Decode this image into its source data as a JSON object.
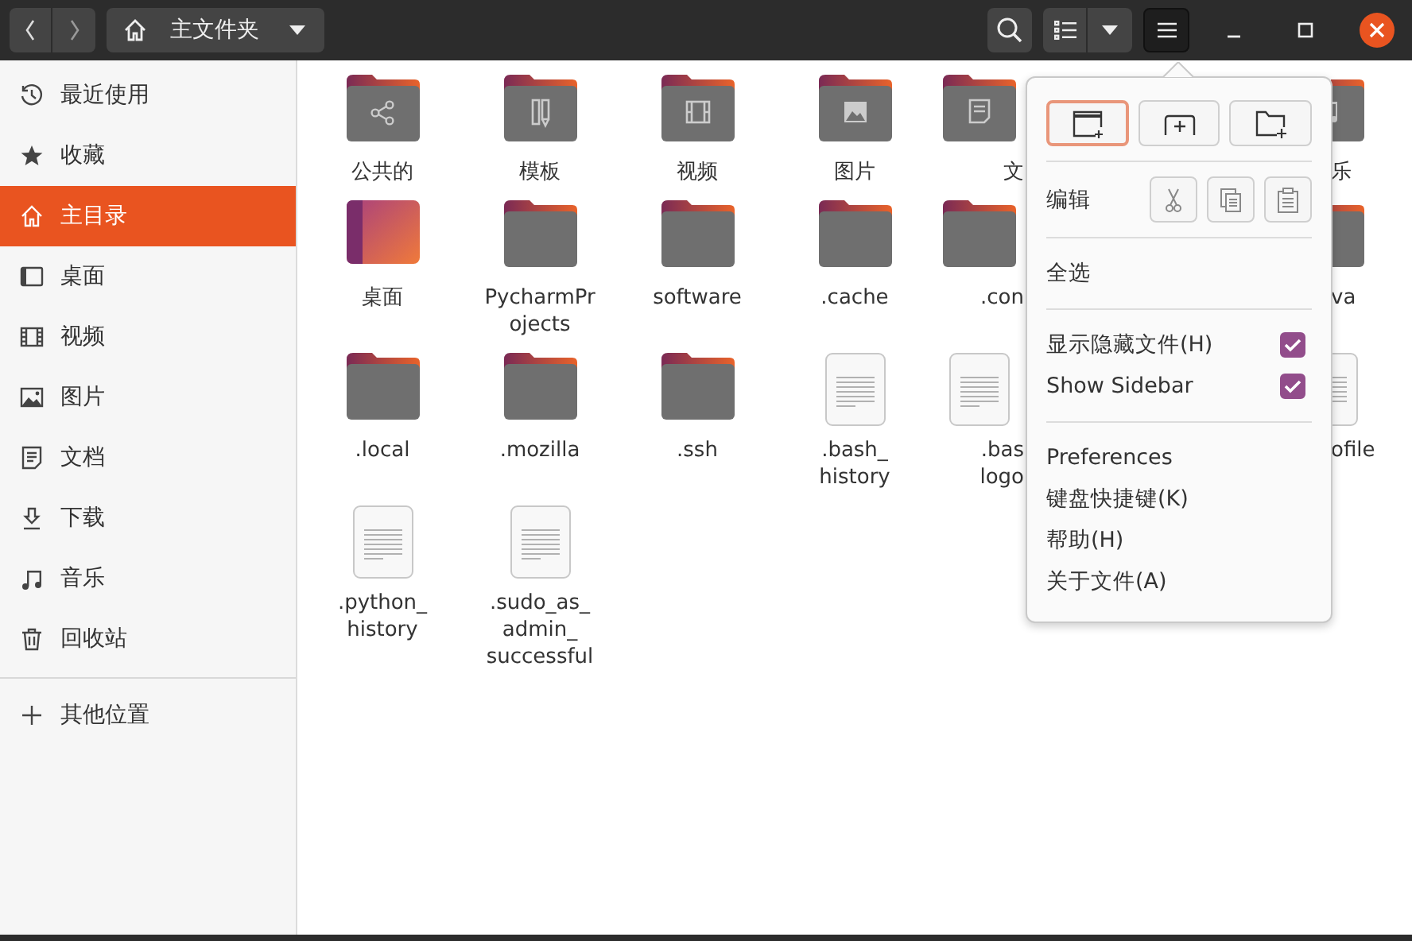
{
  "header": {
    "location": "主文件夹"
  },
  "sidebar": {
    "items": [
      {
        "label": "最近使用",
        "kind": "recent",
        "selected": false
      },
      {
        "label": "收藏",
        "kind": "starred",
        "selected": false
      },
      {
        "label": "主目录",
        "kind": "home",
        "selected": true
      },
      {
        "label": "桌面",
        "kind": "desktop",
        "selected": false
      },
      {
        "label": "视频",
        "kind": "video",
        "selected": false
      },
      {
        "label": "图片",
        "kind": "pictures",
        "selected": false
      },
      {
        "label": "文档",
        "kind": "documents",
        "selected": false
      },
      {
        "label": "下载",
        "kind": "downloads",
        "selected": false
      },
      {
        "label": "音乐",
        "kind": "music",
        "selected": false
      },
      {
        "label": "回收站",
        "kind": "trash",
        "selected": false
      }
    ],
    "other": {
      "label": "其他位置"
    }
  },
  "files": {
    "rows": [
      {
        "items": [
          {
            "name_lines": [
              "公共的"
            ],
            "kind": "share"
          },
          {
            "name_lines": [
              "模板"
            ],
            "kind": "templates"
          },
          {
            "name_lines": [
              "视频"
            ],
            "kind": "video"
          },
          {
            "name_lines": [
              "图片"
            ],
            "kind": "pictures"
          },
          {
            "name_lines": [
              "文"
            ],
            "kind": "documents",
            "covered_right": true
          },
          {
            "name_lines": [
              "乐"
            ],
            "kind": "music",
            "covered_left": true
          }
        ]
      },
      {
        "items": [
          {
            "name_lines": [
              "桌面"
            ],
            "kind": "desktop"
          },
          {
            "name_lines": [
              "PycharmPr",
              "ojects"
            ],
            "kind": "folder"
          },
          {
            "name_lines": [
              "software"
            ],
            "kind": "folder"
          },
          {
            "name_lines": [
              ".cache"
            ],
            "kind": "folder"
          },
          {
            "name_lines": [
              ".con"
            ],
            "kind": "folder",
            "covered_right": true
          },
          {
            "name_lines": [
              "va"
            ],
            "kind": "folder",
            "covered_left": true
          }
        ]
      },
      {
        "items": [
          {
            "name_lines": [
              ".local"
            ],
            "kind": "folder"
          },
          {
            "name_lines": [
              ".mozilla"
            ],
            "kind": "folder"
          },
          {
            "name_lines": [
              ".ssh"
            ],
            "kind": "folder"
          },
          {
            "name_lines": [
              ".bash_",
              "history"
            ],
            "kind": "text"
          },
          {
            "name_lines": [
              ".bas",
              "logo"
            ],
            "kind": "text",
            "covered_right": true
          },
          {
            "name_lines": [
              "ofile"
            ],
            "kind": "text",
            "covered_left": true
          }
        ]
      },
      {
        "items": [
          {
            "name_lines": [
              ".python_",
              "history"
            ],
            "kind": "text"
          },
          {
            "name_lines": [
              ".sudo_as_",
              "admin_",
              "successful"
            ],
            "kind": "text"
          }
        ]
      }
    ]
  },
  "menu": {
    "edit_label": "编辑",
    "select_all": "全选",
    "toggles": [
      {
        "label": "显示隐藏文件(H)",
        "checked": true
      },
      {
        "label": "Show Sidebar",
        "checked": true
      }
    ],
    "items": [
      "Preferences",
      "键盘快捷键(K)",
      "帮助(H)",
      "关于文件(A)"
    ]
  }
}
